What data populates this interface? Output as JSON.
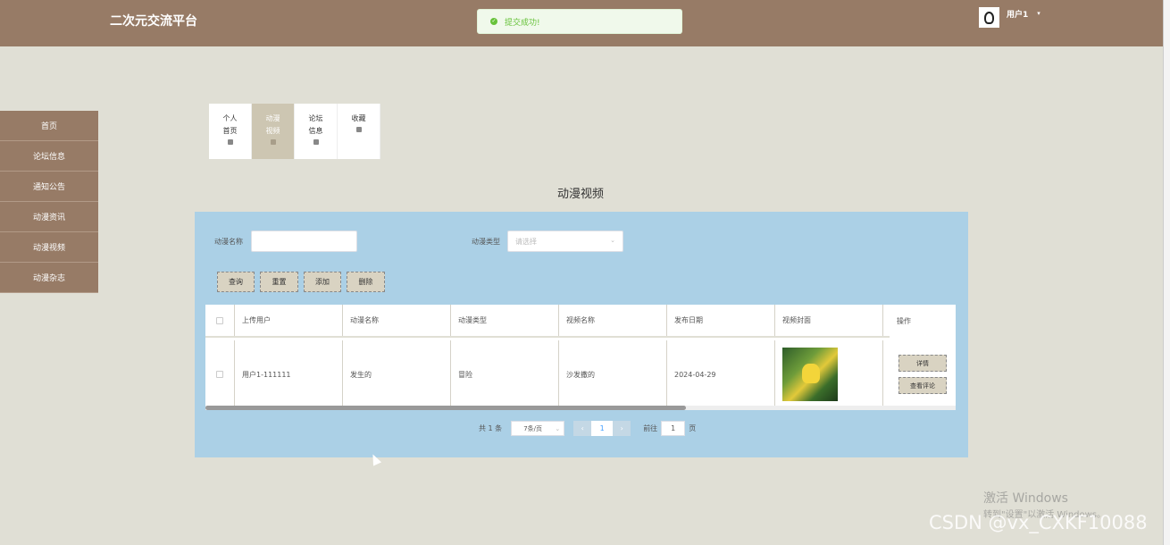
{
  "header": {
    "site_title": "二次元交流平台",
    "toast_text": "提交成功!",
    "user_name": "用户1",
    "user_caret": "▾"
  },
  "sidebar": {
    "items": [
      {
        "label": "首页"
      },
      {
        "label": "论坛信息"
      },
      {
        "label": "通知公告"
      },
      {
        "label": "动漫资讯"
      },
      {
        "label": "动漫视频"
      },
      {
        "label": "动漫杂志"
      }
    ]
  },
  "subtabs": [
    {
      "label": "个人首页",
      "active": false
    },
    {
      "label": "动漫视频",
      "active": true
    },
    {
      "label": "论坛信息",
      "active": false
    },
    {
      "label": "收藏",
      "active": false
    }
  ],
  "page_heading": "动漫视频",
  "search": {
    "name_label": "动漫名称",
    "name_value": "",
    "type_label": "动漫类型",
    "type_placeholder": "请选择"
  },
  "buttons": {
    "query": "查询",
    "reset": "重置",
    "add": "添加",
    "delete": "删除"
  },
  "table": {
    "columns": [
      "上传用户",
      "动漫名称",
      "动漫类型",
      "视频名称",
      "发布日期",
      "视频封面",
      "操作"
    ],
    "rows": [
      {
        "uploader": "用户1-111111",
        "anime_name": "发生的",
        "anime_type": "冒险",
        "video_name": "沙发撒的",
        "publish_date": "2024-04-29",
        "actions": {
          "detail": "详情",
          "comments": "查看评论"
        }
      }
    ],
    "scroll_position": 0.64
  },
  "pagination": {
    "total_text": "共 1 条",
    "page_size": "7条/页",
    "current_page": "1",
    "goto_label": "前往",
    "goto_value": "1",
    "page_suffix": "页",
    "prev": "‹",
    "next": "›"
  },
  "watermarks": {
    "activate_title": "激活 Windows",
    "activate_sub": "转到\"设置\"以激活 Windows。",
    "csdn": "CSDN @vx_CXKF10088"
  },
  "colors": {
    "brand": "#977b66",
    "background": "#e0dfd5",
    "panel": "#abd0e6",
    "success": "#67c23a"
  }
}
